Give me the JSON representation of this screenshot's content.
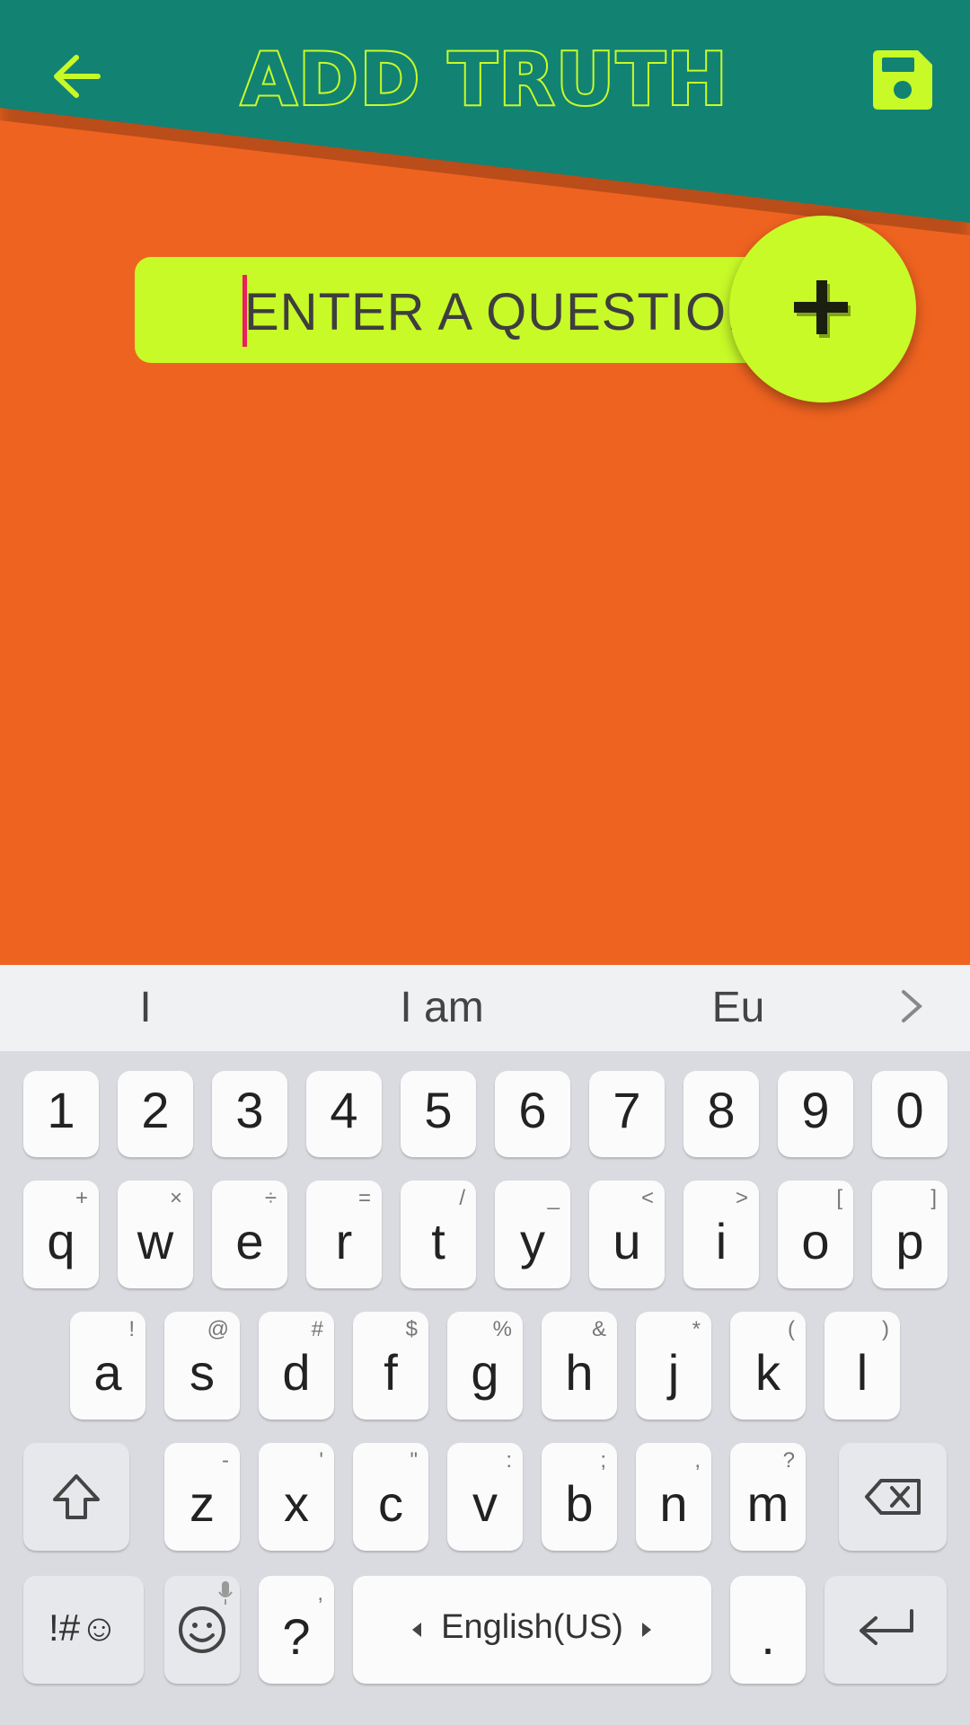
{
  "colors": {
    "header": "#128272",
    "accent": "#c8fa28",
    "background": "#ef6320",
    "caret": "#e91e63",
    "keyboard": "#dadbe0"
  },
  "header": {
    "back_icon": "arrow-left-icon",
    "title": "ADD TRUTH",
    "save_icon": "floppy-disk-icon"
  },
  "question": {
    "placeholder": "ENTER A QUESTION",
    "add_icon": "plus-icon"
  },
  "keyboard": {
    "suggestions": [
      "I",
      "I am",
      "Eu"
    ],
    "suggestion_more_icon": "chevron-right-icon",
    "number_row": [
      "1",
      "2",
      "3",
      "4",
      "5",
      "6",
      "7",
      "8",
      "9",
      "0"
    ],
    "row1": [
      {
        "key": "q",
        "hint": "+"
      },
      {
        "key": "w",
        "hint": "×"
      },
      {
        "key": "e",
        "hint": "÷"
      },
      {
        "key": "r",
        "hint": "="
      },
      {
        "key": "t",
        "hint": "/"
      },
      {
        "key": "y",
        "hint": "_"
      },
      {
        "key": "u",
        "hint": "<"
      },
      {
        "key": "i",
        "hint": ">"
      },
      {
        "key": "o",
        "hint": "["
      },
      {
        "key": "p",
        "hint": "]"
      }
    ],
    "row2": [
      {
        "key": "a",
        "hint": "!"
      },
      {
        "key": "s",
        "hint": "@"
      },
      {
        "key": "d",
        "hint": "#"
      },
      {
        "key": "f",
        "hint": "$"
      },
      {
        "key": "g",
        "hint": "%"
      },
      {
        "key": "h",
        "hint": "&"
      },
      {
        "key": "j",
        "hint": "*"
      },
      {
        "key": "k",
        "hint": "("
      },
      {
        "key": "l",
        "hint": ")"
      }
    ],
    "row3": [
      {
        "key": "z",
        "hint": "-"
      },
      {
        "key": "x",
        "hint": "'"
      },
      {
        "key": "c",
        "hint": "\""
      },
      {
        "key": "v",
        "hint": ":"
      },
      {
        "key": "b",
        "hint": ";"
      },
      {
        "key": "n",
        "hint": ","
      },
      {
        "key": "m",
        "hint": "?"
      }
    ],
    "shift_icon": "shift-arrow-icon",
    "backspace_icon": "backspace-icon",
    "symbols_label": "!#☺",
    "emoji_icon": "emoji-icon",
    "mic_icon": "microphone-icon",
    "question_key": "?",
    "question_hint": ",",
    "space_label": "English(US)",
    "period_key": ".",
    "enter_icon": "enter-icon"
  }
}
